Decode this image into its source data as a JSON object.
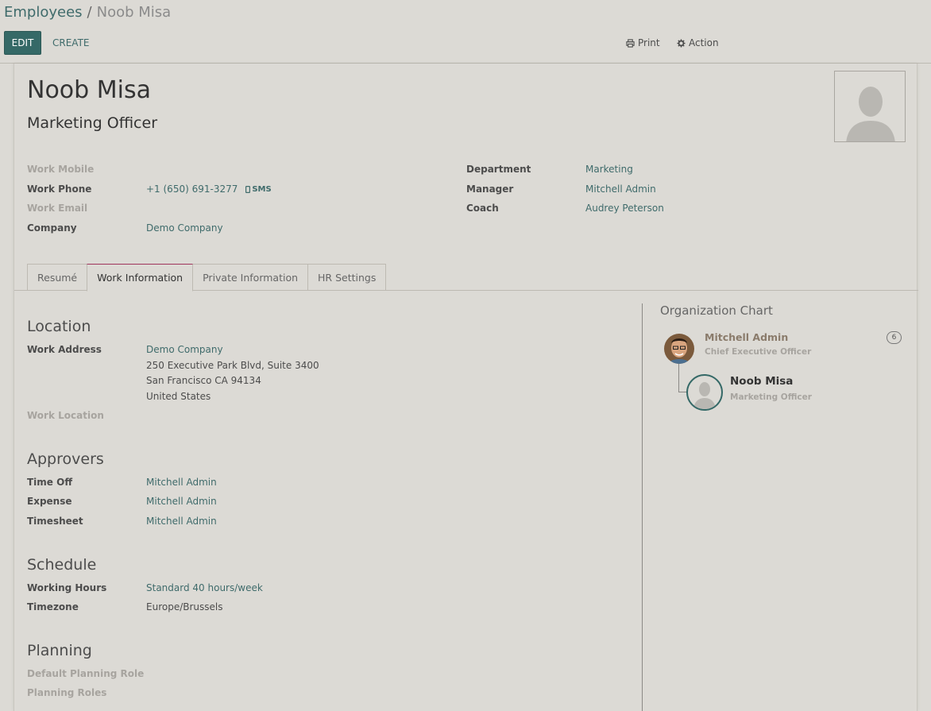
{
  "breadcrumb": {
    "parent": "Employees",
    "separator": "/",
    "current": "Noob Misa"
  },
  "toolbar": {
    "edit_label": "EDIT",
    "create_label": "CREATE",
    "print_label": "Print",
    "action_label": "Action"
  },
  "employee": {
    "name": "Noob Misa",
    "job_title": "Marketing Officer"
  },
  "contact": {
    "work_mobile_label": "Work Mobile",
    "work_phone_label": "Work Phone",
    "work_phone_value": "+1 (650) 691-3277",
    "sms_label": "SMS",
    "work_email_label": "Work Email",
    "company_label": "Company",
    "company_value": "Demo Company",
    "department_label": "Department",
    "department_value": "Marketing",
    "manager_label": "Manager",
    "manager_value": "Mitchell Admin",
    "coach_label": "Coach",
    "coach_value": "Audrey Peterson"
  },
  "tabs": [
    {
      "label": "Resumé",
      "active": false
    },
    {
      "label": "Work Information",
      "active": true
    },
    {
      "label": "Private Information",
      "active": false
    },
    {
      "label": "HR Settings",
      "active": false
    }
  ],
  "location": {
    "title": "Location",
    "work_address_label": "Work Address",
    "address_line1": "Demo Company",
    "address_line2": "250 Executive Park Blvd, Suite 3400",
    "address_line3": "San Francisco CA 94134",
    "address_line4": "United States",
    "work_location_label": "Work Location"
  },
  "approvers": {
    "title": "Approvers",
    "time_off_label": "Time Off",
    "time_off_value": "Mitchell Admin",
    "expense_label": "Expense",
    "expense_value": "Mitchell Admin",
    "timesheet_label": "Timesheet",
    "timesheet_value": "Mitchell Admin"
  },
  "schedule": {
    "title": "Schedule",
    "working_hours_label": "Working Hours",
    "working_hours_value": "Standard 40 hours/week",
    "timezone_label": "Timezone",
    "timezone_value": "Europe/Brussels"
  },
  "planning": {
    "title": "Planning",
    "default_role_label": "Default Planning Role",
    "roles_label": "Planning Roles"
  },
  "org_chart": {
    "title": "Organization Chart",
    "manager_name": "Mitchell Admin",
    "manager_job": "Chief Executive Officer",
    "manager_count": "6",
    "self_name": "Noob Misa",
    "self_job": "Marketing Officer"
  },
  "colors": {
    "primary": "#356967",
    "link": "#3f6b6b",
    "background": "#dcdad5",
    "active_tab_accent": "#a0345c"
  }
}
